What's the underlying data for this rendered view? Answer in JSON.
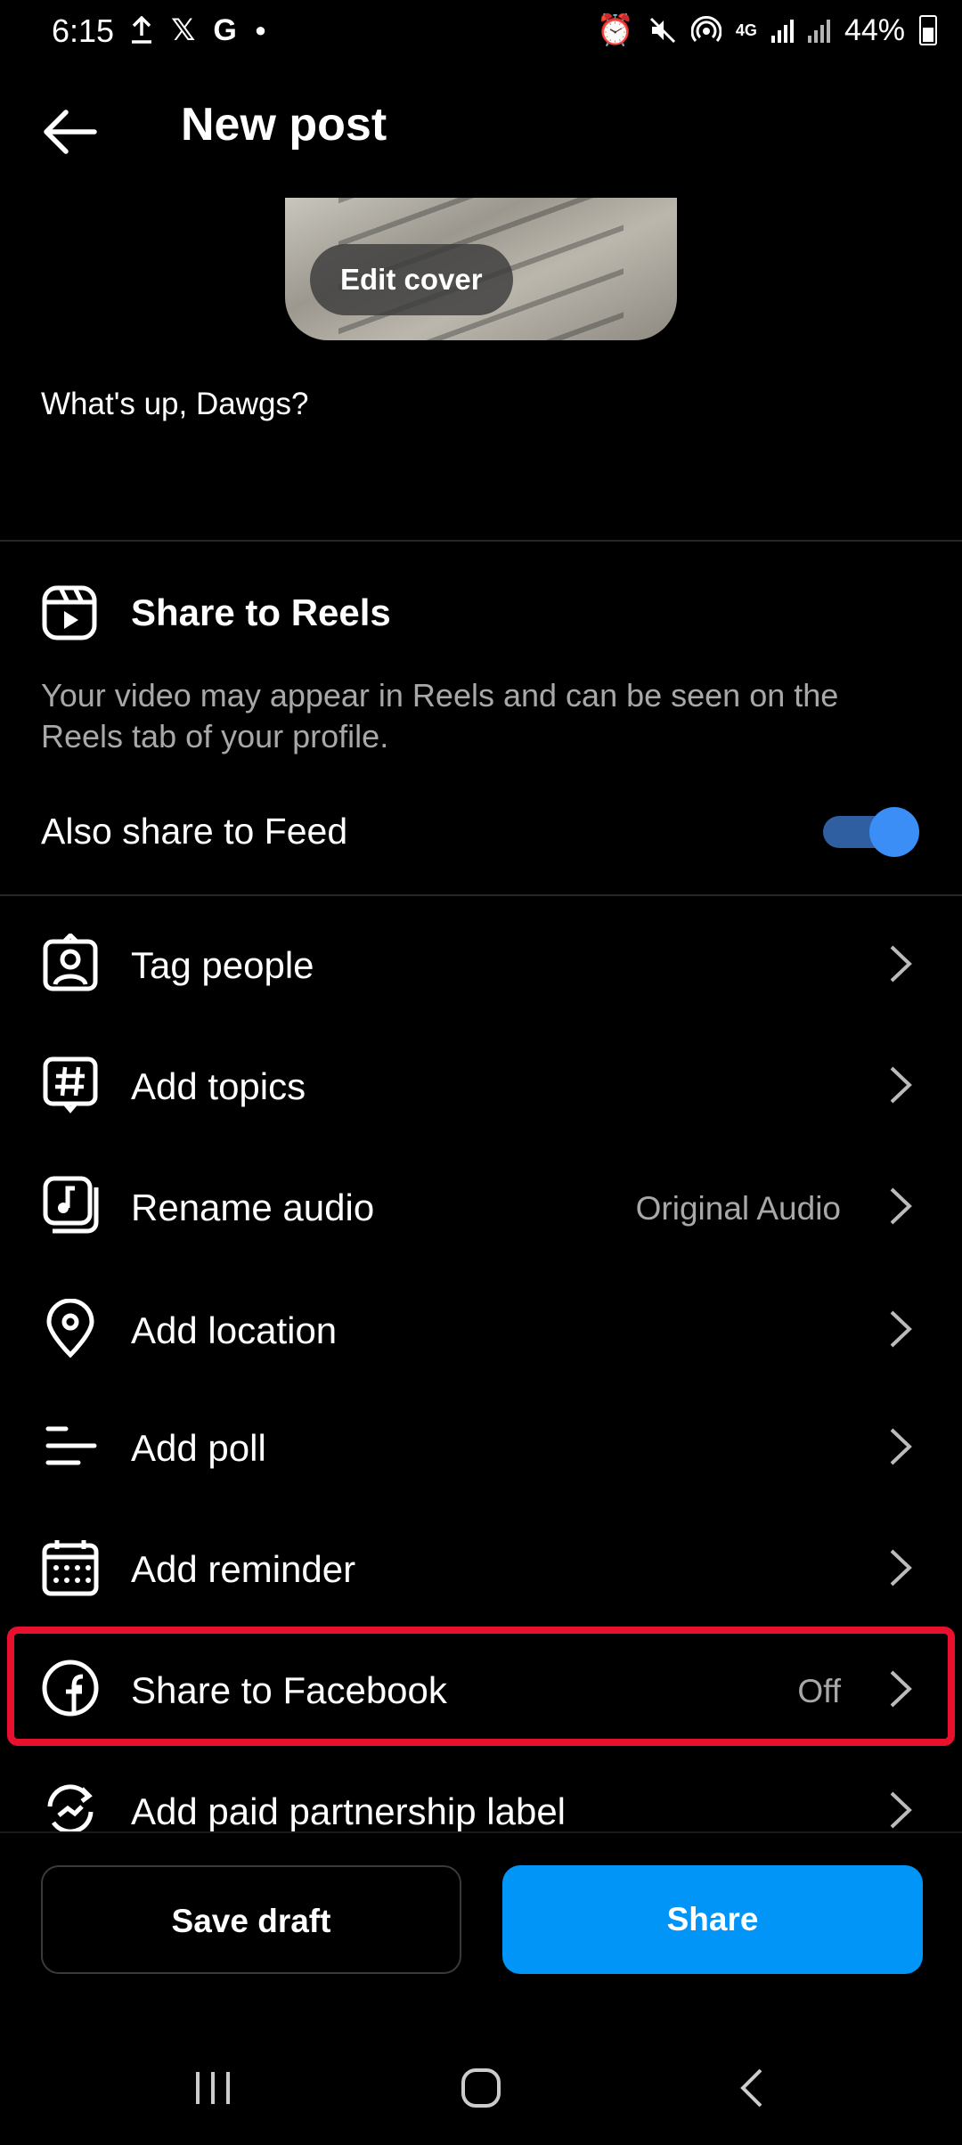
{
  "status_bar": {
    "time": "6:15",
    "battery": "44%",
    "network": "4G",
    "left_icons": [
      "upload-icon",
      "x-logo-icon",
      "google-icon",
      "dot-icon"
    ],
    "right_icons": [
      "alarm-icon",
      "mute-icon",
      "hotspot-icon",
      "signal-icon",
      "battery-icon"
    ]
  },
  "header": {
    "title": "New post"
  },
  "cover": {
    "edit_label": "Edit cover"
  },
  "caption": "What's up, Dawgs?",
  "reels": {
    "title": "Share to Reels",
    "description": "Your video may appear in Reels and can be seen on the Reels tab of your profile.",
    "feed_label": "Also share to Feed",
    "feed_enabled": true,
    "toggle_color": "#3a8ef6"
  },
  "options": [
    {
      "label": "Tag people",
      "icon": "tag-people-icon",
      "value": ""
    },
    {
      "label": "Add topics",
      "icon": "hashtag-icon",
      "value": ""
    },
    {
      "label": "Rename audio",
      "icon": "audio-icon",
      "value": "Original Audio"
    },
    {
      "label": "Add location",
      "icon": "location-icon",
      "value": ""
    },
    {
      "label": "Add poll",
      "icon": "poll-icon",
      "value": ""
    },
    {
      "label": "Add reminder",
      "icon": "calendar-icon",
      "value": ""
    },
    {
      "label": "Share to Facebook",
      "icon": "facebook-icon",
      "value": "Off",
      "highlighted": true
    },
    {
      "label": "Add paid partnership label",
      "icon": "partnership-icon",
      "value": ""
    }
  ],
  "highlight_color": "#e8102e",
  "buttons": {
    "save_draft": "Save draft",
    "share": "Share",
    "share_color": "#0095f6"
  },
  "nav": [
    "recents-icon",
    "home-icon",
    "back-icon"
  ]
}
